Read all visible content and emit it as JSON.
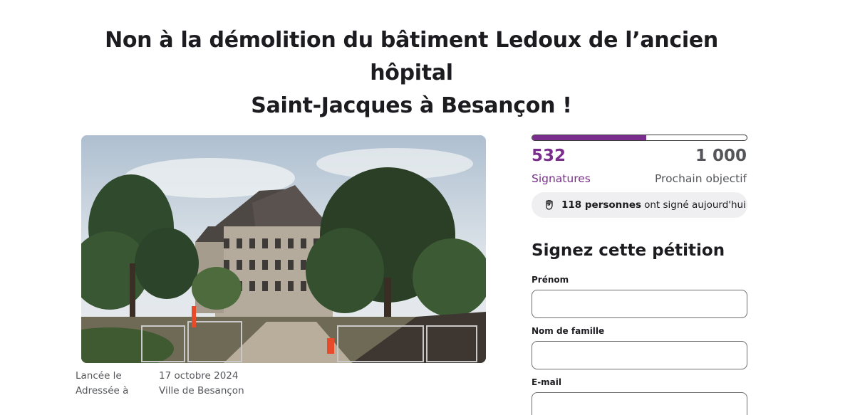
{
  "petition": {
    "title_line1": "Non à la démolition du bâtiment Ledoux de l’ancien hôpital",
    "title_line2": "Saint-Jacques à Besançon !",
    "launched_label": "Lancée le",
    "launched_value": "17 octobre 2024",
    "addressed_label": "Adressée à",
    "addressed_value": "Ville de Besançon"
  },
  "progress": {
    "signatures_count": "532",
    "signatures_label": "Signatures",
    "goal_count": "1 000",
    "goal_label": "Prochain objectif",
    "fraction": 0.532,
    "color": "#7a2d8c"
  },
  "today": {
    "icon": "raised-fist-icon",
    "count_text": "118 personnes",
    "rest_text": "ont signé aujourd'hui"
  },
  "form": {
    "title": "Signez cette pétition",
    "first_name_label": "Prénom",
    "first_name_value": "",
    "last_name_label": "Nom de famille",
    "last_name_value": "",
    "email_label": "E-mail",
    "email_value": ""
  }
}
